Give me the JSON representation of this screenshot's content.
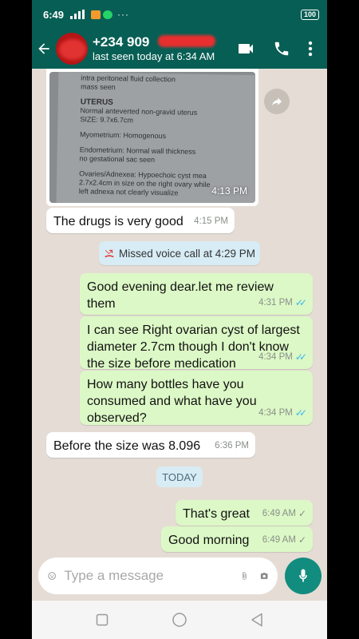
{
  "status_bar": {
    "time": "6:49",
    "battery": "100",
    "more": "···"
  },
  "header": {
    "contact_name": "+234 909",
    "last_seen": "last seen today at 6:34 AM"
  },
  "image_message": {
    "time": "4:13 PM",
    "document_lines": [
      "intra peritoneal fluid collection",
      "mass seen",
      "UTERUS",
      "Normal anteverted non-gravid uterus",
      "SIZE: 9.7x6.7cm",
      "Myometrium: Homogenous",
      "Endometrium: Normal wall thickness",
      "no gestational sac seen",
      "Ovaries/Adnexea: Hypoechoic cyst mea",
      "2.7x2.4cm in size on the right ovary while",
      "left adnexa not clearly visualize"
    ]
  },
  "messages": [
    {
      "direction": "in",
      "text": "The drugs is very good",
      "time": "4:15 PM"
    },
    {
      "direction": "out",
      "text": "Good evening dear.let me review them",
      "time": "4:31 PM"
    },
    {
      "direction": "out",
      "text": "I can see Right ovarian cyst of largest diameter 2.7cm though I don't know the size before medication",
      "time": "4:34 PM"
    },
    {
      "direction": "out",
      "text": "How many bottles have you consumed and what have you observed?",
      "time": "4:34 PM"
    },
    {
      "direction": "in",
      "text": "Before the size was 8.096",
      "time": "6:36 PM"
    },
    {
      "direction": "out",
      "text": "That's great",
      "time": "6:49 AM"
    },
    {
      "direction": "out",
      "text": "Good morning",
      "time": "6:49 AM"
    }
  ],
  "system_message": {
    "text": "Missed voice call at 4:29 PM"
  },
  "day_separator": "TODAY",
  "input": {
    "placeholder": "Type a message",
    "value": ""
  },
  "icons": {
    "back": "arrow-back",
    "video": "videocam",
    "call": "phone",
    "menu": "more-vert",
    "forward": "share-forward",
    "missed": "missed-call",
    "emoji": "emoji",
    "attach": "paperclip",
    "camera": "camera",
    "mic": "microphone"
  },
  "colors": {
    "header": "#075e54",
    "outgoing": "#dcf8c6",
    "incoming": "#ffffff",
    "background": "#e5ddd5",
    "accent": "#128c7e",
    "read_tick": "#34b7f1"
  }
}
